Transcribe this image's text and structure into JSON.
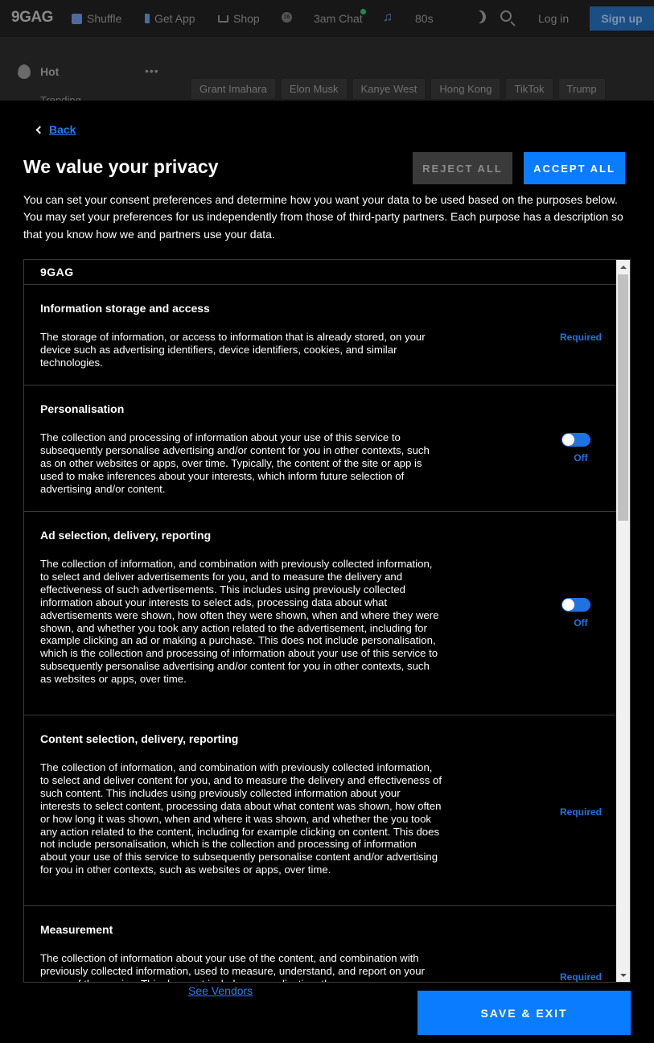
{
  "site": {
    "logo": "9GAG",
    "nav": [
      {
        "label": "Shuffle",
        "icon": "shuffle-icon"
      },
      {
        "label": "Get App",
        "icon": "phone-icon"
      },
      {
        "label": "Shop",
        "icon": "cart-icon"
      },
      {
        "label": "",
        "icon": "age-16-icon",
        "badge": "16"
      },
      {
        "label": "3am Chat",
        "icon": "chat-icon"
      },
      {
        "label": "80s",
        "icon": "music-icon"
      }
    ],
    "login": "Log in",
    "signup": "Sign up",
    "sidebar": {
      "hot": "Hot",
      "trending": "Trending"
    },
    "chips": [
      "Grant Imahara",
      "Elon Musk",
      "Kanye West",
      "Hong Kong",
      "TikTok",
      "Trump"
    ]
  },
  "consent": {
    "back": "Back",
    "title": "We value your privacy",
    "reject_all": "REJECT ALL",
    "accept_all": "ACCEPT ALL",
    "intro": "You can set your consent preferences and determine how you want your data to be used based on the purposes below. You may set your preferences for us independently from those of third-party partners. Each purpose has a description so that you know how we and partners use your data.",
    "vendor": "9GAG",
    "purposes": [
      {
        "title": "Information storage and access",
        "description": "The storage of information, or access to information that is already stored, on your device such as advertising identifiers, device identifiers, cookies, and similar technologies.",
        "status": "Required"
      },
      {
        "title": "Personalisation",
        "description": "The collection and processing of information about your use of this service to subsequently personalise advertising and/or content for you in other contexts, such as on other websites or apps, over time. Typically, the content of the site or app is used to make inferences about your interests, which inform future selection of advertising and/or content.",
        "status": "Off"
      },
      {
        "title": "Ad selection, delivery, reporting",
        "description": "The collection of information, and combination with previously collected information, to select and deliver advertisements for you, and to measure the delivery and effectiveness of such advertisements. This includes using previously collected information about your interests to select ads, processing data about what advertisements were shown, how often they were shown, when and where they were shown, and whether you took any action related to the advertisement, including for example clicking an ad or making a purchase. This does not include personalisation, which is the collection and processing of information about your use of this service to subsequently personalise advertising and/or content for you in other contexts, such as websites or apps, over time.",
        "status": "Off"
      },
      {
        "title": "Content selection, delivery, reporting",
        "description": "The collection of information, and combination with previously collected information, to select and deliver content for you, and to measure the delivery and effectiveness of such content. This includes using previously collected information about your interests to select content, processing data about what content was shown, how often or how long it was shown, when and where it was shown, and whether the you took any action related to the content, including for example clicking on content. This does not include personalisation, which is the collection and processing of information about your use of this service to subsequently personalise content and/or advertising for you in other contexts, such as websites or apps, over time.",
        "status": "Required"
      },
      {
        "title": "Measurement",
        "description": "The collection of information about your use of the content, and combination with previously collected information, used to measure, understand, and report on your usage of the service. This does not include personalisation, the",
        "status": "Required"
      }
    ],
    "see_vendors": "See Vendors",
    "save_exit": "SAVE & EXIT"
  }
}
